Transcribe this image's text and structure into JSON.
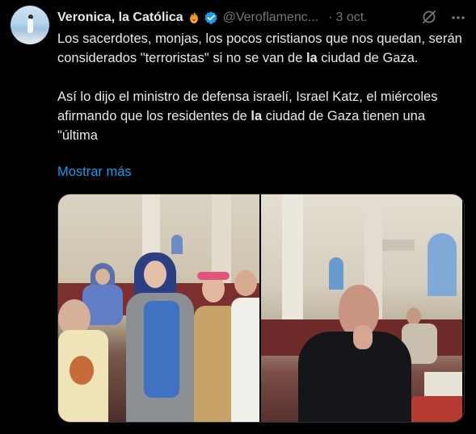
{
  "author": {
    "name": "Veronica, la Católica",
    "handle": "@Veroflamenc...",
    "date_separator": "·",
    "date": "3 oct.",
    "avatar_icon": "avatar-beach-figure",
    "badge_icon": "fire-heart-emoji",
    "verified_icon": "verified-badge",
    "verified_color": "#1d9bf0"
  },
  "actions": {
    "grok_icon": "grok-slash-icon",
    "more_icon": "more-dots-icon"
  },
  "tweet": {
    "p1_a": "Los sacerdotes, monjas, los pocos cristianos que nos quedan, serán considerados \"terroristas\" si no se van de ",
    "p1_bold": "la",
    "p1_b": " ciudad de Gaza.",
    "p2_a": "Así lo dijo el ministro de defensa israelí, Israel Katz, el miércoles afirmando que los residentes de ",
    "p2_bold": "la",
    "p2_b": " ciudad de Gaza tienen una \"última",
    "show_more": "Mostrar más"
  },
  "media": {
    "photos": [
      {
        "name": "nuns-and-children-in-church-photo"
      },
      {
        "name": "priest-praying-rosary-photo"
      }
    ]
  },
  "colors": {
    "background": "#000000",
    "text": "#e7e9ea",
    "muted": "#71767b",
    "link": "#1d9bf0"
  }
}
